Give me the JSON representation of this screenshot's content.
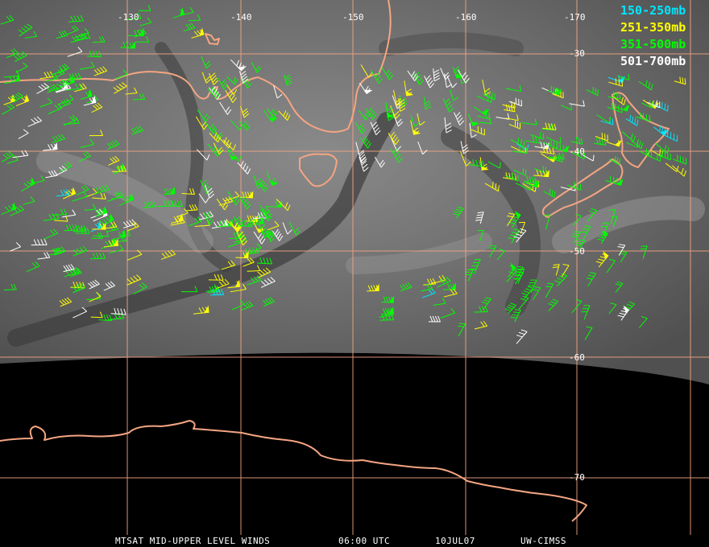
{
  "map": {
    "longitude_labels": [
      "-130",
      "-140",
      "-150",
      "-160",
      "-170"
    ],
    "latitude_labels": [
      "-30",
      "-40",
      "-50",
      "-60",
      "-70"
    ],
    "legend": [
      {
        "label": "150-250mb",
        "color": "#00e5ff"
      },
      {
        "label": "251-350mb",
        "color": "#ffff00"
      },
      {
        "label": "351-500mb",
        "color": "#00ff00"
      },
      {
        "label": "501-700mb",
        "color": "#ffffff"
      }
    ],
    "footer": {
      "product": "MTSAT MID-UPPER LEVEL WINDS",
      "time": "06:00 UTC",
      "date": "10JUL07",
      "source": "UW-CIMSS"
    },
    "colors": {
      "coastline": "#f4a582",
      "grid": "#f4a582",
      "satellite_fill": "#6e6e6e",
      "background": "#000000"
    }
  }
}
